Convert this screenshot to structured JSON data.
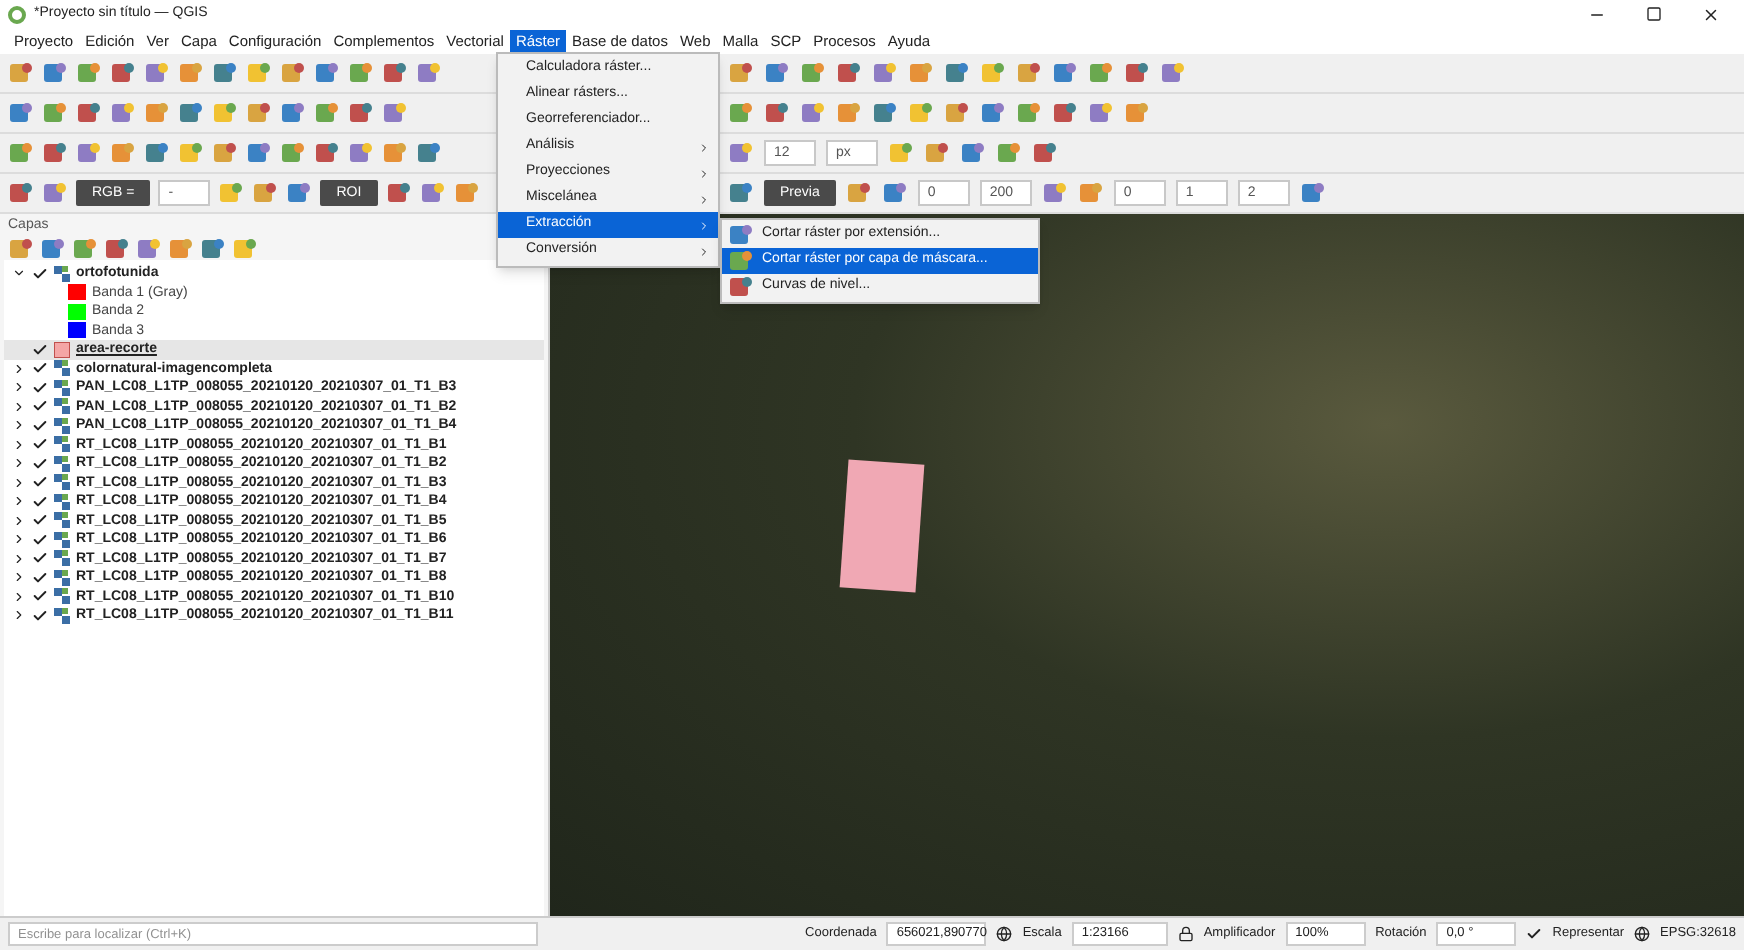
{
  "window": {
    "title": "*Proyecto sin título — QGIS"
  },
  "menu_bar": [
    {
      "label": "Proyecto",
      "selected": false
    },
    {
      "label": "Edición",
      "selected": false
    },
    {
      "label": "Ver",
      "selected": false
    },
    {
      "label": "Capa",
      "selected": false
    },
    {
      "label": "Configuración",
      "selected": false
    },
    {
      "label": "Complementos",
      "selected": false
    },
    {
      "label": "Vectorial",
      "selected": false
    },
    {
      "label": "Ráster",
      "selected": true
    },
    {
      "label": "Base de datos",
      "selected": false
    },
    {
      "label": "Web",
      "selected": false
    },
    {
      "label": "Malla",
      "selected": false
    },
    {
      "label": "SCP",
      "selected": false
    },
    {
      "label": "Procesos",
      "selected": false
    },
    {
      "label": "Ayuda",
      "selected": false
    }
  ],
  "toolbars": [
    {
      "left": [
        {
          "kind": "icon"
        },
        {
          "kind": "icon"
        },
        {
          "kind": "icon"
        },
        {
          "kind": "icon"
        },
        {
          "kind": "icon"
        },
        {
          "kind": "icon"
        },
        {
          "kind": "icon"
        },
        {
          "kind": "icon"
        },
        {
          "kind": "icon"
        },
        {
          "kind": "icon"
        },
        {
          "kind": "icon"
        },
        {
          "kind": "icon"
        },
        {
          "kind": "icon"
        }
      ],
      "right": [
        {
          "kind": "icon"
        },
        {
          "kind": "icon"
        },
        {
          "kind": "icon"
        },
        {
          "kind": "icon"
        },
        {
          "kind": "icon"
        },
        {
          "kind": "icon"
        },
        {
          "kind": "icon"
        },
        {
          "kind": "icon"
        },
        {
          "kind": "icon"
        },
        {
          "kind": "icon"
        },
        {
          "kind": "icon"
        },
        {
          "kind": "icon"
        },
        {
          "kind": "icon"
        }
      ]
    },
    {
      "left": [
        {
          "kind": "icon"
        },
        {
          "kind": "icon"
        },
        {
          "kind": "icon"
        },
        {
          "kind": "icon"
        },
        {
          "kind": "icon"
        },
        {
          "kind": "icon"
        },
        {
          "kind": "icon"
        },
        {
          "kind": "icon"
        },
        {
          "kind": "icon"
        },
        {
          "kind": "icon"
        },
        {
          "kind": "icon"
        },
        {
          "kind": "icon"
        }
      ],
      "right": [
        {
          "kind": "icon"
        },
        {
          "kind": "icon"
        },
        {
          "kind": "icon"
        },
        {
          "kind": "icon"
        },
        {
          "kind": "icon"
        },
        {
          "kind": "icon"
        },
        {
          "kind": "icon"
        },
        {
          "kind": "icon"
        },
        {
          "kind": "icon"
        },
        {
          "kind": "icon"
        },
        {
          "kind": "icon"
        },
        {
          "kind": "icon"
        }
      ]
    },
    {
      "left": [
        {
          "kind": "icon"
        },
        {
          "kind": "icon"
        },
        {
          "kind": "icon"
        },
        {
          "kind": "icon"
        },
        {
          "kind": "icon"
        },
        {
          "kind": "icon"
        },
        {
          "kind": "icon"
        },
        {
          "kind": "icon"
        },
        {
          "kind": "icon"
        },
        {
          "kind": "icon"
        },
        {
          "kind": "icon"
        },
        {
          "kind": "icon"
        },
        {
          "kind": "icon"
        }
      ],
      "right": [
        {
          "kind": "icon"
        },
        {
          "kind": "field",
          "value": "12"
        },
        {
          "kind": "field",
          "value": "px"
        },
        {
          "kind": "icon"
        },
        {
          "kind": "icon"
        },
        {
          "kind": "icon"
        },
        {
          "kind": "icon"
        },
        {
          "kind": "icon"
        }
      ]
    },
    {
      "left": [
        {
          "kind": "icon"
        },
        {
          "kind": "icon"
        },
        {
          "kind": "button",
          "label": "RGB ="
        },
        {
          "kind": "field",
          "value": "-"
        },
        {
          "kind": "icon"
        },
        {
          "kind": "icon"
        },
        {
          "kind": "icon"
        },
        {
          "kind": "button",
          "label": "ROI"
        },
        {
          "kind": "icon"
        },
        {
          "kind": "icon"
        },
        {
          "kind": "icon"
        }
      ],
      "right": [
        {
          "kind": "icon"
        },
        {
          "kind": "button",
          "label": "Previa"
        },
        {
          "kind": "icon"
        },
        {
          "kind": "icon"
        },
        {
          "kind": "field",
          "value": "0"
        },
        {
          "kind": "field",
          "value": "200"
        },
        {
          "kind": "icon"
        },
        {
          "kind": "icon"
        },
        {
          "kind": "field",
          "value": "0"
        },
        {
          "kind": "field",
          "value": "1"
        },
        {
          "kind": "field",
          "value": "2"
        },
        {
          "kind": "icon"
        }
      ]
    }
  ],
  "layers_panel": {
    "title": "Capas",
    "layers": [
      {
        "name": "ortofotunida",
        "kind": "raster",
        "checked": true,
        "expanded": true,
        "selected": false,
        "children": [
          {
            "name": "Banda 1 (Gray)",
            "color": "#ff0000"
          },
          {
            "name": "Banda 2",
            "color": "#00ff00"
          },
          {
            "name": "Banda 3",
            "color": "#0000ff"
          }
        ]
      },
      {
        "name": "area-recorte",
        "kind": "vector",
        "checked": true,
        "selected": true
      },
      {
        "name": "colornatural-imagencompleta",
        "kind": "raster",
        "checked": true,
        "expanded": false,
        "selected": false
      },
      {
        "name": "PAN_LC08_L1TP_008055_20210120_20210307_01_T1_B3",
        "kind": "raster",
        "checked": true,
        "expanded": false,
        "selected": false
      },
      {
        "name": "PAN_LC08_L1TP_008055_20210120_20210307_01_T1_B2",
        "kind": "raster",
        "checked": true,
        "expanded": false,
        "selected": false
      },
      {
        "name": "PAN_LC08_L1TP_008055_20210120_20210307_01_T1_B4",
        "kind": "raster",
        "checked": true,
        "expanded": false,
        "selected": false
      },
      {
        "name": "RT_LC08_L1TP_008055_20210120_20210307_01_T1_B1",
        "kind": "raster",
        "checked": true,
        "expanded": false,
        "selected": false
      },
      {
        "name": "RT_LC08_L1TP_008055_20210120_20210307_01_T1_B2",
        "kind": "raster",
        "checked": true,
        "expanded": false,
        "selected": false
      },
      {
        "name": "RT_LC08_L1TP_008055_20210120_20210307_01_T1_B3",
        "kind": "raster",
        "checked": true,
        "expanded": false,
        "selected": false
      },
      {
        "name": "RT_LC08_L1TP_008055_20210120_20210307_01_T1_B4",
        "kind": "raster",
        "checked": true,
        "expanded": false,
        "selected": false
      },
      {
        "name": "RT_LC08_L1TP_008055_20210120_20210307_01_T1_B5",
        "kind": "raster",
        "checked": true,
        "expanded": false,
        "selected": false
      },
      {
        "name": "RT_LC08_L1TP_008055_20210120_20210307_01_T1_B6",
        "kind": "raster",
        "checked": true,
        "expanded": false,
        "selected": false
      },
      {
        "name": "RT_LC08_L1TP_008055_20210120_20210307_01_T1_B7",
        "kind": "raster",
        "checked": true,
        "expanded": false,
        "selected": false
      },
      {
        "name": "RT_LC08_L1TP_008055_20210120_20210307_01_T1_B8",
        "kind": "raster",
        "checked": true,
        "expanded": false,
        "selected": false
      },
      {
        "name": "RT_LC08_L1TP_008055_20210120_20210307_01_T1_B10",
        "kind": "raster",
        "checked": true,
        "expanded": false,
        "selected": false
      },
      {
        "name": "RT_LC08_L1TP_008055_20210120_20210307_01_T1_B11",
        "kind": "raster",
        "checked": true,
        "expanded": false,
        "selected": false
      }
    ]
  },
  "raster_menu": {
    "items": [
      {
        "label": "Calculadora ráster...",
        "submenu": false,
        "selected": false
      },
      {
        "label": "Alinear rásters...",
        "submenu": false,
        "selected": false
      },
      {
        "label": "Georreferenciador...",
        "submenu": false,
        "selected": false
      },
      {
        "label": "Análisis",
        "submenu": true,
        "selected": false
      },
      {
        "label": "Proyecciones",
        "submenu": true,
        "selected": false
      },
      {
        "label": "Miscelánea",
        "submenu": true,
        "selected": false
      },
      {
        "label": "Extracción",
        "submenu": true,
        "selected": true
      },
      {
        "label": "Conversión",
        "submenu": true,
        "selected": false
      }
    ]
  },
  "extraction_submenu": {
    "items": [
      {
        "label": "Cortar ráster por extensión...",
        "selected": false
      },
      {
        "label": "Cortar ráster por capa de máscara...",
        "selected": true
      },
      {
        "label": "Curvas de nivel...",
        "selected": false
      }
    ]
  },
  "status_bar": {
    "search": {
      "placeholder": "Escribe para localizar (Ctrl+K)"
    },
    "coordinate_label": "Coordenada",
    "coordinate": "656021,890770",
    "scale_label": "Escala",
    "scale": "1:23166",
    "magnifier_label": "Amplificador",
    "magnifier": "100%",
    "rotation_label": "Rotación",
    "rotation": "0,0 °",
    "render": {
      "label": "Representar",
      "checked": true
    },
    "crs": "EPSG:32618"
  }
}
